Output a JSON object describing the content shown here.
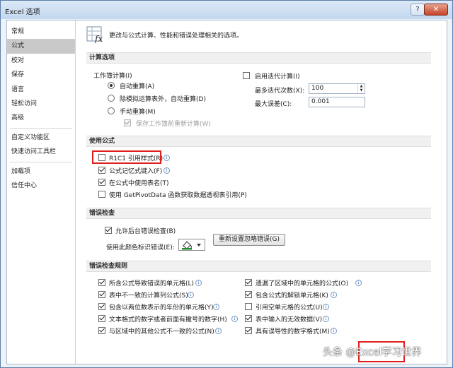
{
  "window": {
    "title": "Excel 选项",
    "help_label": "?",
    "close_label": "✕"
  },
  "sidebar": {
    "items": [
      {
        "label": "常规"
      },
      {
        "label": "公式"
      },
      {
        "label": "校对"
      },
      {
        "label": "保存"
      },
      {
        "label": "语言"
      },
      {
        "label": "轻松访问"
      },
      {
        "label": "高级"
      },
      {
        "label": "自定义功能区"
      },
      {
        "label": "快速访问工具栏"
      },
      {
        "label": "加载项"
      },
      {
        "label": "信任中心"
      }
    ],
    "active": "公式"
  },
  "header": {
    "text": "更改与公式计算、性能和错误处理相关的选项。",
    "icon": "formula-fx-icon"
  },
  "calc": {
    "section": "计算选项",
    "workbook_label": "工作簿计算(I)",
    "auto": "自动重算(A)",
    "auto_except": "除模拟运算表外，自动重算(D)",
    "manual": "手动重算(M)",
    "recalc_before_save": "保存工作簿前重新计算(W)",
    "iterative": "启用迭代计算(I)",
    "max_iter_label": "最多迭代次数(X):",
    "max_iter_value": "100",
    "max_change_label": "最大误差(C):",
    "max_change_value": "0.001"
  },
  "formulas": {
    "section": "使用公式",
    "r1c1": "R1C1 引用样式(R)",
    "autocomplete": "公式记忆式键入(F)",
    "table_names": "在公式中使用表名(T)",
    "getpivot": "使用 GetPivotData 函数获取数据透视表引用(P)"
  },
  "error_check": {
    "section": "错误检查",
    "background": "允许后台错误检查(B)",
    "color_label": "使用此颜色标识错误(E):",
    "reset_button": "重新设置忽略错误(G)"
  },
  "rules": {
    "section": "错误检查规则",
    "left": [
      {
        "label": "所含公式导致错误的单元格(L)",
        "checked": true
      },
      {
        "label": "表中不一致的计算列公式(S)",
        "checked": true
      },
      {
        "label": "包含以两位数表示的年份的单元格(Y)",
        "checked": true
      },
      {
        "label": "文本格式的数字或者前面有撇号的数字(H)",
        "checked": true
      },
      {
        "label": "与区域中的其他公式不一致的公式(N)",
        "checked": true
      }
    ],
    "right": [
      {
        "label": "遗漏了区域中的单元格的公式(O)",
        "checked": true
      },
      {
        "label": "包含公式的解锁单元格(K)",
        "checked": true
      },
      {
        "label": "引用空单元格的公式(U)",
        "checked": false
      },
      {
        "label": "表中输入的无效数据(V)",
        "checked": true
      },
      {
        "label": "具有误导性的数字格式(M)",
        "checked": true
      }
    ]
  },
  "watermark": "头条 @Excel学习世界",
  "colors": {
    "accent_red": "#e0201c",
    "sidebar_active": "#c9c9c9",
    "section_bg": "#f0f0f0"
  }
}
